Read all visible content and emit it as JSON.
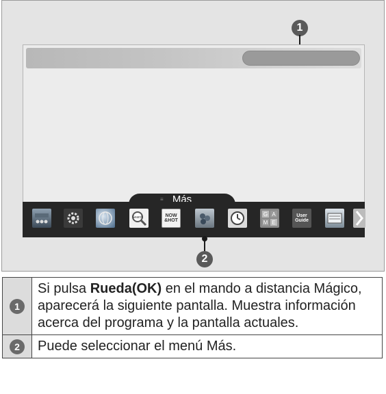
{
  "illustration": {
    "callout_top": "1",
    "callout_bottom": "2",
    "menu_tab_label": "Más",
    "menu_icons": [
      {
        "name": "input-icon",
        "label": ""
      },
      {
        "name": "settings-icon",
        "label": ""
      },
      {
        "name": "internet-icon",
        "label": ""
      },
      {
        "name": "search-icon",
        "label": "Search"
      },
      {
        "name": "now-hot-icon",
        "label": "NOW &HOT"
      },
      {
        "name": "apps-icon",
        "label": ""
      },
      {
        "name": "clock-icon",
        "label": ""
      },
      {
        "name": "game-icon",
        "label": "GAME"
      },
      {
        "name": "user-guide-icon",
        "label": "User Guide"
      },
      {
        "name": "photo-icon",
        "label": ""
      },
      {
        "name": "next-arrow-icon",
        "label": ""
      }
    ]
  },
  "table": {
    "rows": [
      {
        "number": "1",
        "text_before": "Si pulsa ",
        "bold": "Rueda(OK)",
        "text_after": " en el mando a distancia Mágico, aparecerá la siguiente pantalla. Muestra información acerca del programa y la pantalla actuales."
      },
      {
        "number": "2",
        "text": "Puede seleccionar el menú Más."
      }
    ]
  }
}
